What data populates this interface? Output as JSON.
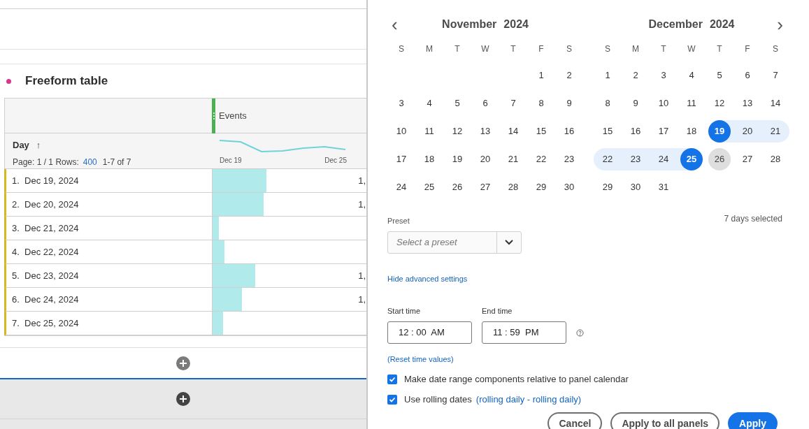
{
  "panel": {
    "title": "Freeform table"
  },
  "table": {
    "metric_header": "Events",
    "dimension_header": "Day",
    "sort": "↑",
    "page_label": "Page: 1 / 1 Rows:",
    "rows_per_page": "400",
    "range": "1-7 of 7",
    "sparkline_start": "Dec 19",
    "sparkline_end": "Dec 25",
    "rows": [
      {
        "label": "1.  Dec 19, 2024",
        "level": 0.35,
        "value": "1,"
      },
      {
        "label": "2.  Dec 20, 2024",
        "level": 0.33,
        "value": "1,"
      },
      {
        "label": "3.  Dec 21, 2024",
        "level": 0.04
      },
      {
        "label": "4.  Dec 22, 2024",
        "level": 0.075
      },
      {
        "label": "5.  Dec 23, 2024",
        "level": 0.275,
        "value": "1,"
      },
      {
        "label": "6.  Dec 24, 2024",
        "level": 0.19,
        "value": "1,"
      },
      {
        "label": "7.  Dec 25, 2024",
        "level": 0.07
      }
    ]
  },
  "calendar": {
    "prev": "‹",
    "next": "›",
    "months": [
      {
        "month": "November",
        "year": "2024",
        "weekdays": [
          "S",
          "M",
          "T",
          "W",
          "T",
          "F",
          "S"
        ],
        "weeks": [
          [
            {
              "kind": "blank"
            },
            {
              "kind": "blank"
            },
            {
              "kind": "blank"
            },
            {
              "kind": "blank"
            },
            {
              "kind": "blank"
            },
            {
              "day": "1",
              "kind": "normal"
            },
            {
              "day": "2",
              "kind": "normal"
            }
          ],
          [
            {
              "day": "3",
              "kind": "normal"
            },
            {
              "day": "4",
              "kind": "normal"
            },
            {
              "day": "5",
              "kind": "normal"
            },
            {
              "day": "6",
              "kind": "normal"
            },
            {
              "day": "7",
              "kind": "normal"
            },
            {
              "day": "8",
              "kind": "normal"
            },
            {
              "day": "9",
              "kind": "normal"
            }
          ],
          [
            {
              "day": "10",
              "kind": "normal"
            },
            {
              "day": "11",
              "kind": "normal"
            },
            {
              "day": "12",
              "kind": "normal"
            },
            {
              "day": "13",
              "kind": "normal"
            },
            {
              "day": "14",
              "kind": "normal"
            },
            {
              "day": "15",
              "kind": "normal"
            },
            {
              "day": "16",
              "kind": "normal"
            }
          ],
          [
            {
              "day": "17",
              "kind": "normal"
            },
            {
              "day": "18",
              "kind": "normal"
            },
            {
              "day": "19",
              "kind": "normal"
            },
            {
              "day": "20",
              "kind": "normal"
            },
            {
              "day": "21",
              "kind": "normal"
            },
            {
              "day": "22",
              "kind": "normal"
            },
            {
              "day": "23",
              "kind": "normal"
            }
          ],
          [
            {
              "day": "24",
              "kind": "normal"
            },
            {
              "day": "25",
              "kind": "normal"
            },
            {
              "day": "26",
              "kind": "normal"
            },
            {
              "day": "27",
              "kind": "normal"
            },
            {
              "day": "28",
              "kind": "normal"
            },
            {
              "day": "29",
              "kind": "normal"
            },
            {
              "day": "30",
              "kind": "normal"
            }
          ]
        ]
      },
      {
        "month": "December",
        "year": "2024",
        "weekdays": [
          "S",
          "M",
          "T",
          "W",
          "T",
          "F",
          "S"
        ],
        "weeks": [
          [
            {
              "day": "1",
              "kind": "normal"
            },
            {
              "day": "2",
              "kind": "normal"
            },
            {
              "day": "3",
              "kind": "normal"
            },
            {
              "day": "4",
              "kind": "normal"
            },
            {
              "day": "5",
              "kind": "normal"
            },
            {
              "day": "6",
              "kind": "normal"
            },
            {
              "day": "7",
              "kind": "normal"
            }
          ],
          [
            {
              "day": "8",
              "kind": "normal"
            },
            {
              "day": "9",
              "kind": "normal"
            },
            {
              "day": "10",
              "kind": "normal"
            },
            {
              "day": "11",
              "kind": "normal"
            },
            {
              "day": "12",
              "kind": "normal"
            },
            {
              "day": "13",
              "kind": "normal"
            },
            {
              "day": "14",
              "kind": "normal"
            }
          ],
          [
            {
              "day": "15",
              "kind": "normal"
            },
            {
              "day": "16",
              "kind": "normal"
            },
            {
              "day": "17",
              "kind": "normal"
            },
            {
              "day": "18",
              "kind": "normal"
            },
            {
              "day": "19",
              "kind": "endpoint"
            },
            {
              "day": "20",
              "kind": "in_range"
            },
            {
              "day": "21",
              "kind": "in_range"
            }
          ],
          [
            {
              "day": "22",
              "kind": "in_range"
            },
            {
              "day": "23",
              "kind": "in_range"
            },
            {
              "day": "24",
              "kind": "in_range"
            },
            {
              "day": "25",
              "kind": "endpoint"
            },
            {
              "day": "26",
              "kind": "today"
            },
            {
              "day": "27",
              "kind": "normal"
            },
            {
              "day": "28",
              "kind": "normal"
            }
          ],
          [
            {
              "day": "29",
              "kind": "normal"
            },
            {
              "day": "30",
              "kind": "normal"
            },
            {
              "day": "31",
              "kind": "normal"
            },
            {
              "kind": "blank"
            },
            {
              "kind": "blank"
            },
            {
              "kind": "blank"
            },
            {
              "kind": "blank"
            }
          ]
        ]
      }
    ]
  },
  "preset": {
    "label": "Preset",
    "placeholder": "Select a preset",
    "summary": "7 days selected"
  },
  "advanced_link": "Hide advanced settings",
  "start_time": {
    "label": "Start time",
    "value": "12 : 00  AM"
  },
  "end_time": {
    "label": "End time",
    "value": "11 : 59  PM"
  },
  "reset_link": "(Reset time values)",
  "options": [
    {
      "label": "Make date range components relative to panel calendar",
      "checked": true
    },
    {
      "label": "Use rolling dates",
      "checked": true,
      "link": "(rolling daily - rolling daily)"
    }
  ],
  "buttons": [
    {
      "label": "Cancel",
      "kind": "secondary"
    },
    {
      "label": "Apply to all panels",
      "kind": "secondary"
    },
    {
      "label": "Apply",
      "kind": "primary"
    }
  ]
}
